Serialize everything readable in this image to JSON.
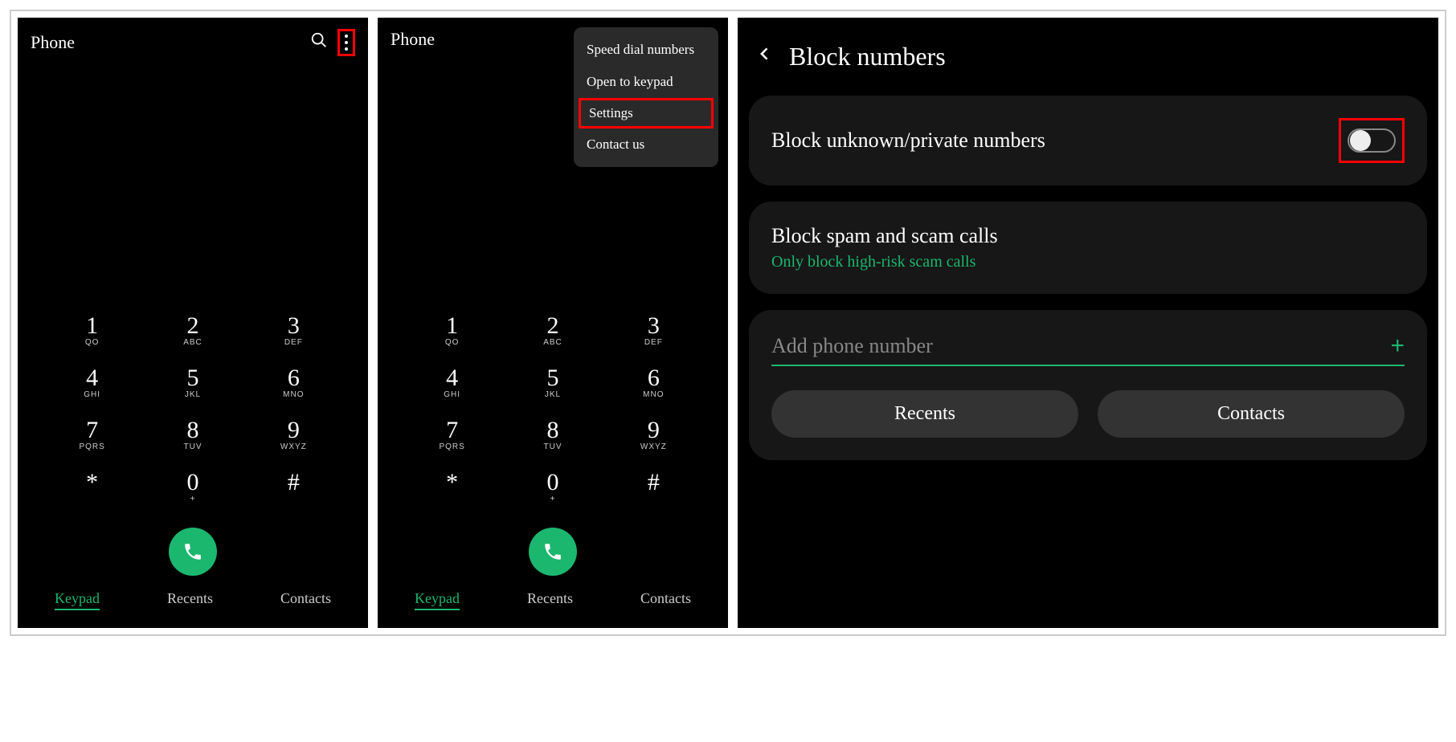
{
  "screen1": {
    "title": "Phone",
    "keys": [
      {
        "num": "1",
        "sub": "QO"
      },
      {
        "num": "2",
        "sub": "ABC"
      },
      {
        "num": "3",
        "sub": "DEF"
      },
      {
        "num": "4",
        "sub": "GHI"
      },
      {
        "num": "5",
        "sub": "JKL"
      },
      {
        "num": "6",
        "sub": "MNO"
      },
      {
        "num": "7",
        "sub": "PQRS"
      },
      {
        "num": "8",
        "sub": "TUV"
      },
      {
        "num": "9",
        "sub": "WXYZ"
      },
      {
        "num": "*",
        "sub": ""
      },
      {
        "num": "0",
        "sub": "+"
      },
      {
        "num": "#",
        "sub": ""
      }
    ],
    "tabs": {
      "keypad": "Keypad",
      "recents": "Recents",
      "contacts": "Contacts"
    }
  },
  "screen2": {
    "title": "Phone",
    "menu": {
      "speed": "Speed dial numbers",
      "open": "Open to keypad",
      "settings": "Settings",
      "contact": "Contact us"
    }
  },
  "screen3": {
    "header": "Block numbers",
    "block_unknown": "Block unknown/private numbers",
    "block_spam": "Block spam and scam calls",
    "block_spam_sub": "Only block high-risk scam calls",
    "add_placeholder": "Add phone number",
    "recents_btn": "Recents",
    "contacts_btn": "Contacts"
  }
}
